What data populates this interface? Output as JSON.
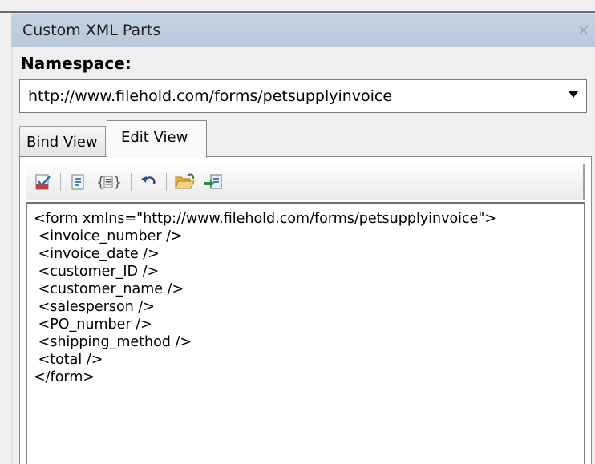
{
  "pane": {
    "title": "Custom XML Parts",
    "close_glyph": "×"
  },
  "namespace": {
    "label": "Namespace:",
    "selected": "http://www.filehold.com/forms/petsupplyinvoice"
  },
  "tabs": [
    {
      "label": "Bind View",
      "active": false
    },
    {
      "label": "Edit View",
      "active": true
    }
  ],
  "toolbar": {
    "buttons": [
      {
        "icon": "validate-icon"
      },
      {
        "icon": "xml-document-icon"
      },
      {
        "icon": "braces-element-icon"
      },
      {
        "icon": "undo-icon"
      },
      {
        "icon": "open-folder-icon"
      },
      {
        "icon": "import-save-icon"
      }
    ]
  },
  "editor": {
    "lines": [
      "<form xmlns=\"http://www.filehold.com/forms/petsupplyinvoice\">",
      " <invoice_number />",
      " <invoice_date />",
      " <customer_ID />",
      " <customer_name />",
      " <salesperson />",
      " <PO_number />",
      " <shipping_method />",
      " <total />",
      "</form>"
    ]
  }
}
